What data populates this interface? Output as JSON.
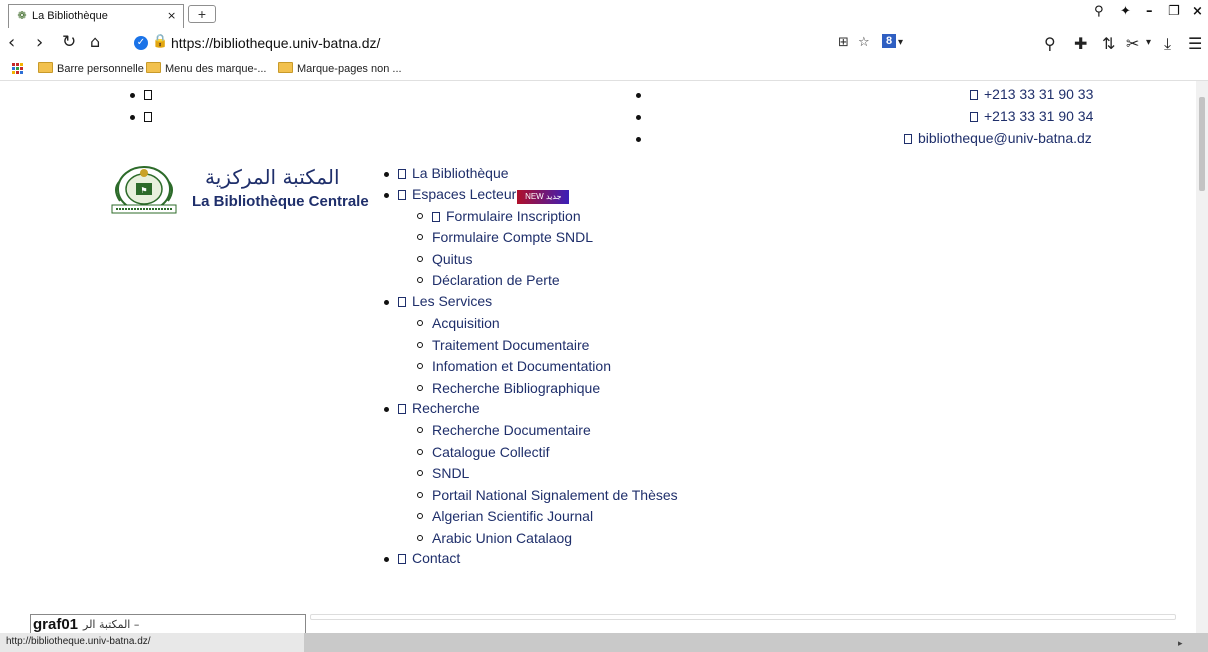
{
  "browser": {
    "tab_title": "La Bibliothèque",
    "tab_close": "×",
    "new_tab": "+",
    "url": "https://bibliotheque.univ-batna.dz/",
    "bookmarks": [
      "Barre personnelle",
      "Menu des marque-...",
      "Marque-pages non ..."
    ],
    "status_url": "http://bibliotheque.univ-batna.dz/",
    "zoom_level_indicator": "8"
  },
  "topbar": {
    "left_items": [
      "",
      ""
    ],
    "contacts": [
      "+213 33 31 90 33",
      "+213 33 31 90 34",
      "bibliotheque@univ-batna.dz"
    ]
  },
  "logo": {
    "arabic_title": "المكتبة المركزية",
    "french_title": "La Bibliothèque Centrale"
  },
  "menu": {
    "items": [
      {
        "label": "La Bibliothèque"
      },
      {
        "label": "Espaces Lecteur",
        "badge": "NEW جديد",
        "children": [
          {
            "label": "Formulaire Inscription",
            "icon": true
          },
          {
            "label": "Formulaire Compte SNDL"
          },
          {
            "label": "Quitus"
          },
          {
            "label": "Déclaration de Perte"
          }
        ]
      },
      {
        "label": "Les Services",
        "children": [
          {
            "label": "Acquisition"
          },
          {
            "label": "Traitement Documentaire"
          },
          {
            "label": "Infomation et Documentation"
          },
          {
            "label": "Recherche Bibliographique"
          }
        ]
      },
      {
        "label": "Recherche",
        "children": [
          {
            "label": "Recherche Documentaire"
          },
          {
            "label": "Catalogue Collectif"
          },
          {
            "label": "SNDL"
          },
          {
            "label": "Portail National Signalement de Thèses"
          },
          {
            "label": "Algerian Scientific Journal"
          },
          {
            "label": "Arabic Union Catalaog"
          }
        ]
      },
      {
        "label": "Contact"
      }
    ]
  },
  "footer_overlay": {
    "bold": "graf01",
    "arabic": "المكتبة الر –"
  }
}
